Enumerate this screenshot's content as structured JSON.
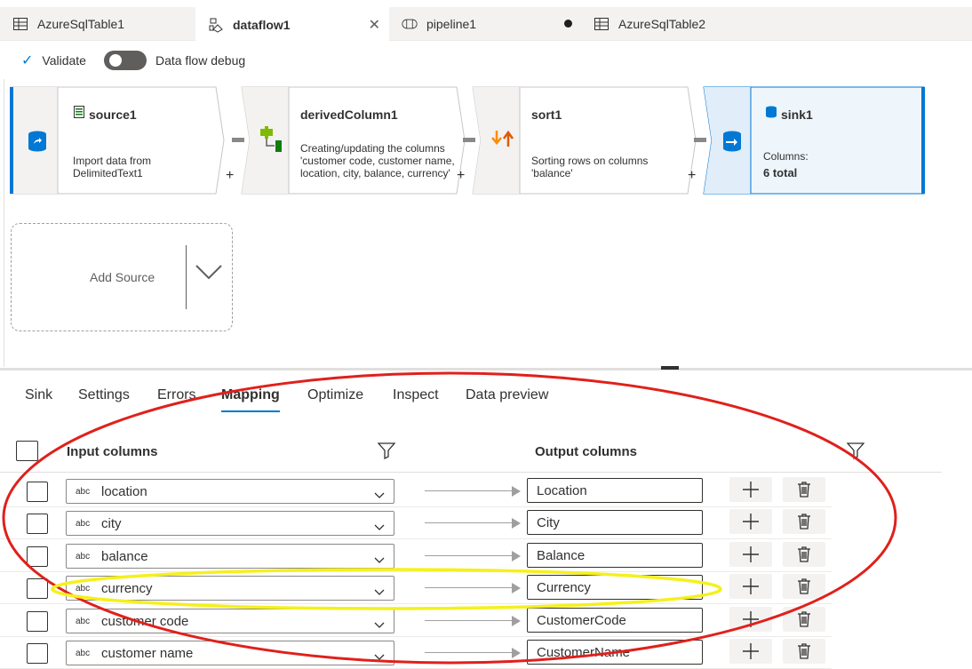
{
  "tabs": [
    {
      "label": "AzureSqlTable1",
      "icon": "table-icon"
    },
    {
      "label": "dataflow1",
      "icon": "dataflow-icon",
      "active": true,
      "close": "✕"
    },
    {
      "label": "pipeline1",
      "icon": "pipeline-icon",
      "unsaved": true
    },
    {
      "label": "AzureSqlTable2",
      "icon": "table-icon"
    }
  ],
  "toolbar": {
    "validate_label": "Validate",
    "debug_label": "Data flow debug",
    "debug_on": false
  },
  "flow": {
    "source": {
      "title": "source1",
      "desc": "Import data from DelimitedText1"
    },
    "derived": {
      "title": "derivedColumn1",
      "desc": "Creating/updating the columns 'customer code, customer name, location, city, balance, currency'"
    },
    "sort": {
      "title": "sort1",
      "desc": "Sorting rows on columns 'balance'"
    },
    "sink": {
      "title": "sink1",
      "desc_label": "Columns:",
      "desc_value": "6 total"
    },
    "add_source_label": "Add Source",
    "plus": "+"
  },
  "panel_tabs": [
    "Sink",
    "Settings",
    "Errors",
    "Mapping",
    "Optimize",
    "Inspect",
    "Data preview"
  ],
  "active_panel_tab": "Mapping",
  "mapping": {
    "input_header": "Input columns",
    "output_header": "Output columns",
    "type_label": "abc",
    "rows": [
      {
        "input": "location",
        "output": "Location"
      },
      {
        "input": "city",
        "output": "City"
      },
      {
        "input": "balance",
        "output": "Balance"
      },
      {
        "input": "currency",
        "output": "Currency"
      },
      {
        "input": "customer code",
        "output": "CustomerCode"
      },
      {
        "input": "customer name",
        "output": "CustomerName"
      }
    ]
  },
  "colors": {
    "accent": "#0078d4",
    "annotation_red": "#e0201b",
    "annotation_yellow": "#f5f01c"
  }
}
